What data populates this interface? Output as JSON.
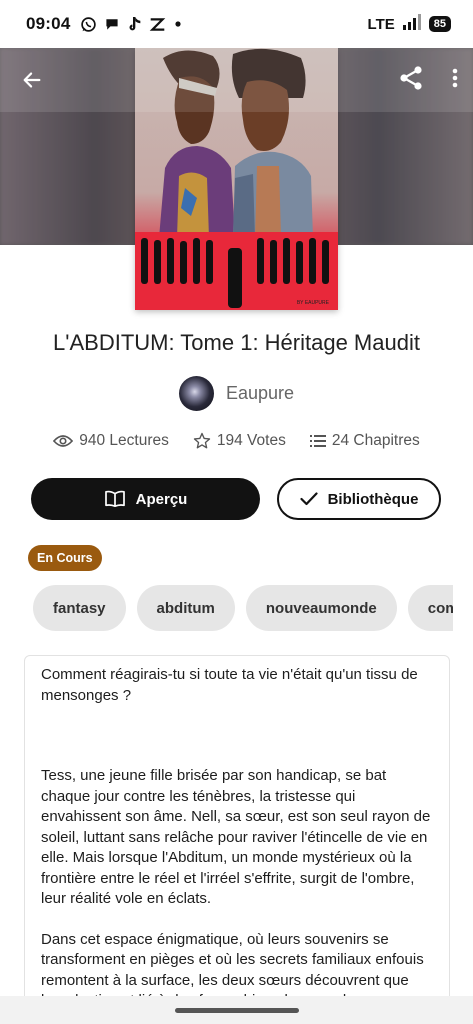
{
  "status_bar": {
    "time": "09:04",
    "network": "LTE",
    "battery": "85",
    "notification_icons": [
      "whatsapp-icon",
      "chat-bubble-icon",
      "tiktok-icon",
      "capcut-icon",
      "dot-icon"
    ]
  },
  "toolbar": {
    "back_icon": "arrow-left-icon",
    "share_icon": "share-icon",
    "more_icon": "more-vertical-icon"
  },
  "cover": {
    "signature": "BY EAUPURE"
  },
  "book": {
    "title": "L'ABDITUM: Tome 1: Héritage Maudit",
    "author": "Eaupure",
    "reads": "940 Lectures",
    "votes": "194 Votes",
    "chapters": "24 Chapitres"
  },
  "actions": {
    "preview_label": "Aperçu",
    "library_label": "Bibliothèque"
  },
  "status_badge": "En Cours",
  "tags": [
    "fantasy",
    "abditum",
    "nouveaumonde",
    "combat"
  ],
  "description": {
    "p1": "Comment réagirais-tu si toute ta vie n'était qu'un tissu de mensonges ?",
    "p2": "    Tess, une jeune fille brisée par son handicap, se bat chaque jour contre les ténèbres, la tristesse qui envahissent son âme. Nell, sa sœur, est son seul rayon de soleil, luttant sans relâche pour raviver l'étincelle de vie en elle. Mais lorsque l'Abditum, un monde mystérieux où la frontière entre le réel et l'irréel s'effrite, surgit de l'ombre, leur réalité vole en éclats.",
    "p3": " Dans cet espace énigmatique, où leurs souvenirs se transforment en pièges et où les secrets familiaux enfouis remontent à la surface, les deux sœurs découvrent que leur destin est lié à des forces bien plus grandes"
  },
  "colors": {
    "badge": "#9a5a0f",
    "primary_button": "#121212",
    "tag_bg": "#e6e6e6"
  }
}
